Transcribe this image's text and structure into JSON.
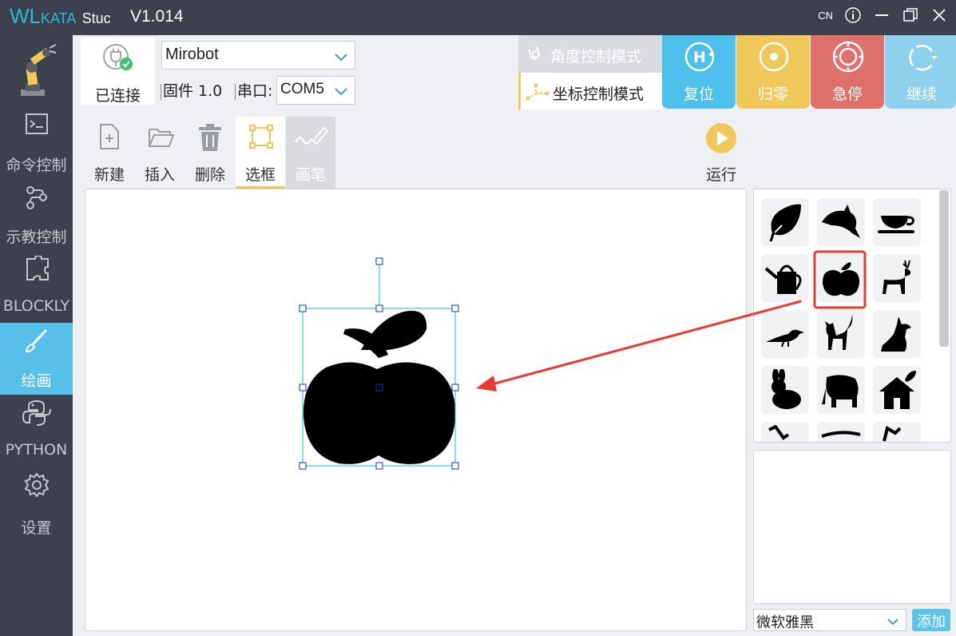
{
  "titlebar": {
    "brand_wl": "WL",
    "brand_kata": "KATA",
    "brand_studio": "Stuc",
    "version": "V1.014",
    "lang": "CN"
  },
  "sidebar": {
    "items": [
      {
        "label": "",
        "icon": "robot-arm-icon"
      },
      {
        "label": "命令控制",
        "icon": "terminal-icon"
      },
      {
        "label": "示教控制",
        "icon": "teach-icon"
      },
      {
        "label": "BLOCKLY",
        "icon": "puzzle-icon"
      },
      {
        "label": "绘画",
        "icon": "brush-icon",
        "active": true
      },
      {
        "label": "PYTHON",
        "icon": "python-icon"
      },
      {
        "label": "设置",
        "icon": "gear-icon"
      }
    ]
  },
  "device": {
    "connect_label": "已连接",
    "model": "Mirobot",
    "firmware": "固件 1.0",
    "port_label": "串口:",
    "port": "COM5"
  },
  "modes": {
    "angle": "角度控制模式",
    "coord": "坐标控制模式",
    "active": "coord"
  },
  "actions": {
    "reset": {
      "label": "复位",
      "color": "#4dc0ec"
    },
    "home": {
      "label": "归零",
      "color": "#f0c95a"
    },
    "stop": {
      "label": "急停",
      "color": "#e0706a"
    },
    "resume": {
      "label": "继续",
      "color": "#8fd0ef"
    }
  },
  "toolbar": {
    "new": "新建",
    "insert": "插入",
    "delete": "删除",
    "select": "选框",
    "pen": "画笔",
    "run": "运行",
    "active": "select"
  },
  "library": {
    "items": [
      "leaf",
      "dolphin",
      "teacup",
      "watering-can",
      "apple",
      "deer",
      "bird",
      "cat",
      "dog",
      "rabbit",
      "elephant",
      "house",
      "partial-1",
      "partial-2",
      "partial-3"
    ],
    "selected": "apple"
  },
  "text_panel": {
    "font": "微软雅黑",
    "add_label": "添加"
  },
  "colors": {
    "accent": "#57c0e8",
    "sidebar": "#3d404d",
    "highlight": "#ea3a2f",
    "selection": "#00c8d7"
  }
}
